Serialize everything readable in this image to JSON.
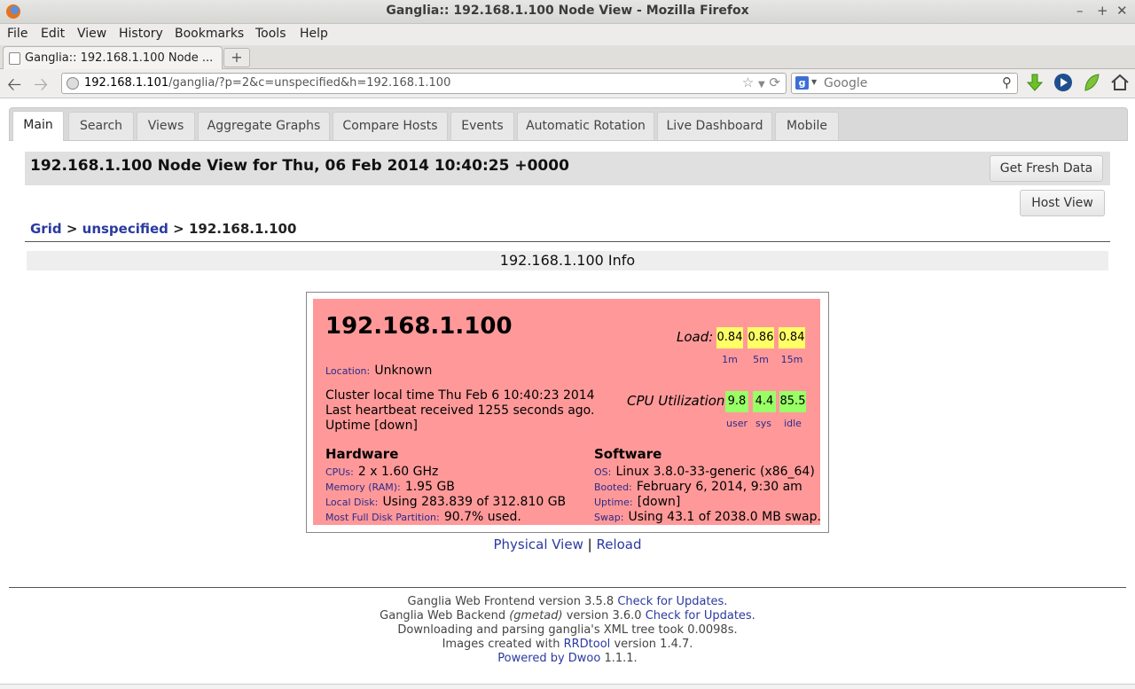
{
  "window": {
    "title": "Ganglia:: 192.168.1.100 Node View - Mozilla Firefox"
  },
  "menu": [
    "File",
    "Edit",
    "View",
    "History",
    "Bookmarks",
    "Tools",
    "Help"
  ],
  "browser_tab": {
    "label": "Ganglia:: 192.168.1.100 Node ...",
    "new_tab": "+"
  },
  "address": {
    "host": "192.168.1.101",
    "path": "/ganglia/?p=2&c=unspecified&h=192.168.1.100"
  },
  "search": {
    "placeholder": "Google",
    "engine": "g"
  },
  "page_tabs": [
    "Main",
    "Search",
    "Views",
    "Aggregate Graphs",
    "Compare Hosts",
    "Events",
    "Automatic Rotation",
    "Live Dashboard",
    "Mobile"
  ],
  "header": {
    "title": "192.168.1.100 Node View for Thu, 06 Feb 2014 10:40:25 +0000",
    "fresh_button": "Get Fresh Data",
    "host_view_button": "Host View"
  },
  "breadcrumb": {
    "grid": "Grid",
    "sep": ">",
    "cluster": "unspecified",
    "host": "192.168.1.100"
  },
  "info_title": "192.168.1.100 Info",
  "node": {
    "host": "192.168.1.100",
    "location_label": "Location:",
    "location": "Unknown",
    "cluster_time": "Cluster local time Thu Feb 6 10:40:23 2014",
    "heartbeat": "Last heartbeat received 1255 seconds ago.",
    "uptime_line": "Uptime [down]",
    "load_label": "Load:",
    "load": [
      {
        "value": "0.84",
        "label": "1m"
      },
      {
        "value": "0.86",
        "label": "5m"
      },
      {
        "value": "0.84",
        "label": "15m"
      }
    ],
    "cpu_label": "CPU Utilization:",
    "cpu": [
      {
        "value": "9.8",
        "label": "user"
      },
      {
        "value": "4.4",
        "label": "sys"
      },
      {
        "value": "85.5",
        "label": "idle"
      }
    ],
    "hardware": {
      "title": "Hardware",
      "cpus_label": "CPUs:",
      "cpus": "2 x 1.60 GHz",
      "mem_label": "Memory (RAM):",
      "mem": "1.95 GB",
      "disk_label": "Local Disk:",
      "disk": "Using 283.839 of 312.810 GB",
      "part_label": "Most Full Disk Partition:",
      "part": "90.7% used."
    },
    "software": {
      "title": "Software",
      "os_label": "OS:",
      "os": "Linux 3.8.0-33-generic (x86_64)",
      "booted_label": "Booted:",
      "booted": "February 6, 2014, 9:30 am",
      "uptime_label": "Uptime:",
      "uptime": "[down]",
      "swap_label": "Swap:",
      "swap": "Using 43.1 of 2038.0 MB swap."
    }
  },
  "links": {
    "physical": "Physical View",
    "sep": "|",
    "reload": "Reload"
  },
  "footer": {
    "l1_text": "Ganglia Web Frontend version 3.5.8",
    "l1_link": "Check for Updates.",
    "l2_a": "Ganglia Web Backend",
    "l2_b": "(gmetad)",
    "l2_c": "version 3.6.0",
    "l2_link": "Check for Updates.",
    "l3": "Downloading and parsing ganglia's XML tree took 0.0098s.",
    "l4_a": "Images created with",
    "l4_link": "RRDtool",
    "l4_b": "version 1.4.7.",
    "l5_link": "Powered by Dwoo",
    "l5_b": "1.1.1."
  },
  "colors": {
    "card_bg": "#ff9999",
    "load_box": "#ffff66",
    "cpu_box": "#99ff66",
    "link": "#2a3aa0"
  }
}
